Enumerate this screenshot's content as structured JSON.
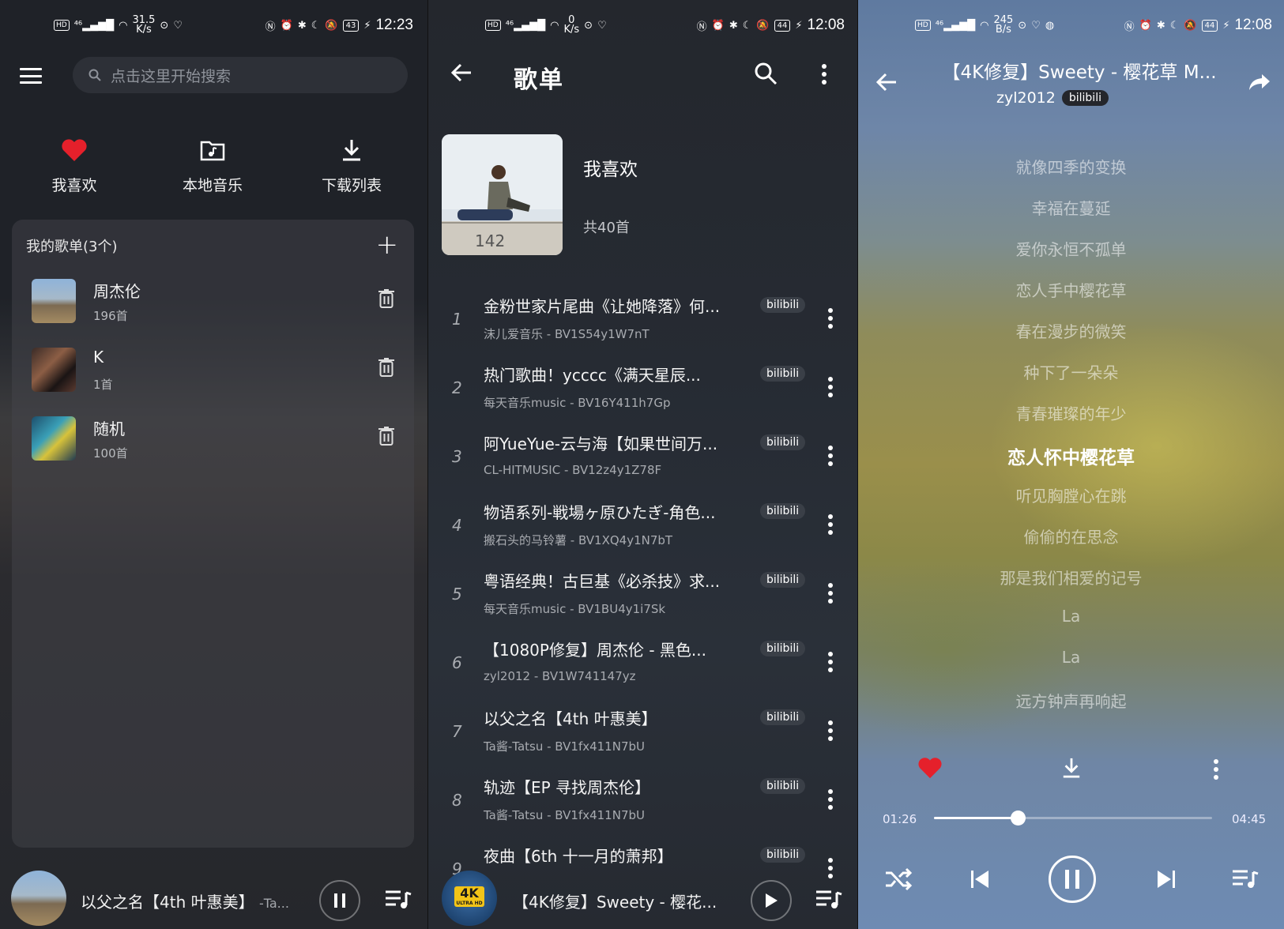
{
  "panel1": {
    "status": {
      "net_speed": "31.5",
      "net_unit": "K/s",
      "battery": "43",
      "time": "12:23"
    },
    "search": {
      "placeholder": "点击这里开始搜索"
    },
    "quick_links": [
      {
        "label": "我喜欢",
        "icon": "heart-icon"
      },
      {
        "label": "本地音乐",
        "icon": "folder-music-icon"
      },
      {
        "label": "下载列表",
        "icon": "download-icon"
      }
    ],
    "playlists": {
      "header": "我的歌单(3个)",
      "items": [
        {
          "name": "周杰伦",
          "count": "196首"
        },
        {
          "name": "K",
          "count": "1首"
        },
        {
          "name": "随机",
          "count": "100首"
        }
      ]
    },
    "mini_player": {
      "title": "以父之名【4th 叶惠美】",
      "subtitle": "-Ta..."
    }
  },
  "panel2": {
    "status": {
      "net_speed": "0",
      "net_unit": "K/s",
      "battery": "44",
      "time": "12:08"
    },
    "title": "歌单",
    "playlist_name": "我喜欢",
    "playlist_count": "共40首",
    "cover_text": "142",
    "songs": [
      {
        "num": "1",
        "title": "金粉世家片尾曲《让她降落》何...",
        "sub": "沫儿爱音乐 - BV1S54y1W7nT",
        "badge": "bilibili"
      },
      {
        "num": "2",
        "title": "热门歌曲！ycccc《满天星辰...",
        "sub": "每天音乐music - BV16Y411h7Gp",
        "badge": "bilibili"
      },
      {
        "num": "3",
        "title": "阿YueYue-云与海【如果世间万...",
        "sub": "CL-HITMUSIC - BV12z4y1Z78F",
        "badge": "bilibili"
      },
      {
        "num": "4",
        "title": "物语系列-戦場ヶ原ひたぎ-角色...",
        "sub": "搬石头的马铃薯 - BV1XQ4y1N7bT",
        "badge": "bilibili"
      },
      {
        "num": "5",
        "title": "粤语经典！古巨基《必杀技》求...",
        "sub": "每天音乐music - BV1BU4y1i7Sk",
        "badge": "bilibili"
      },
      {
        "num": "6",
        "title": "【1080P修复】周杰伦 - 黑色...",
        "sub": "zyl2012 - BV1W741147yz",
        "badge": "bilibili"
      },
      {
        "num": "7",
        "title": "以父之名【4th 叶惠美】",
        "sub": "Ta酱-Tatsu - BV1fx411N7bU",
        "badge": "bilibili"
      },
      {
        "num": "8",
        "title": "轨迹【EP 寻找周杰伦】",
        "sub": "Ta酱-Tatsu - BV1fx411N7bU",
        "badge": "bilibili"
      },
      {
        "num": "9",
        "title": "夜曲【6th 十一月的萧邦】",
        "sub": "",
        "badge": "bilibili"
      }
    ],
    "mini_player": {
      "title": "【4K修复】Sweety - 樱花...",
      "art_text": "4K",
      "art_sub": "ULTRA HD"
    }
  },
  "panel3": {
    "status": {
      "net_speed": "245",
      "net_unit": "B/s",
      "battery": "44",
      "time": "12:08"
    },
    "title": "【4K修复】Sweety - 樱花草 M...",
    "artist": "zyl2012",
    "badge": "bilibili",
    "lyrics": [
      "就像四季的变换",
      "幸福在蔓延",
      "爱你永恒不孤单",
      "恋人手中樱花草",
      "春在漫步的微笑",
      "种下了一朵朵",
      "青春璀璨的年少",
      "恋人怀中樱花草",
      "听见胸膛心在跳",
      "偷偷的在思念",
      "那是我们相爱的记号",
      "La",
      "La",
      "远方钟声再响起"
    ],
    "active_lyric_index": 7,
    "time_elapsed": "01:26",
    "time_total": "04:45",
    "progress": 0.302
  },
  "colors": {
    "heart": "#e5202b",
    "accent": "#ffffff"
  }
}
